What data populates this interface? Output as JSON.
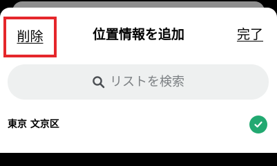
{
  "header": {
    "delete_label": "削除",
    "title": "位置情報を追加",
    "done_label": "完了"
  },
  "search": {
    "placeholder": "リストを検索",
    "icon": "search-icon"
  },
  "list": {
    "items": [
      {
        "label": "東京 文京区",
        "selected": true,
        "icon": "checkmark-icon"
      }
    ]
  },
  "colors": {
    "highlight_border": "#e5272b",
    "check_green": "#22a971",
    "search_bg": "#eef0f0",
    "placeholder_text": "#7b7f82"
  }
}
